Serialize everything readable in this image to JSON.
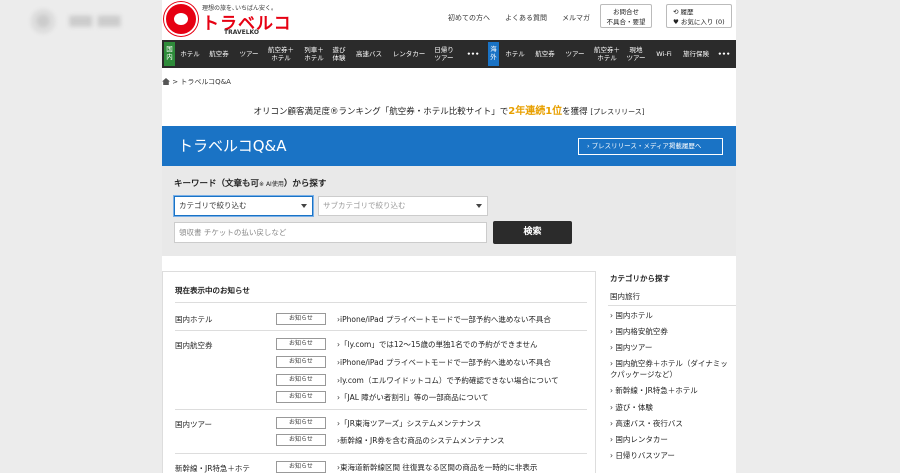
{
  "header": {
    "tagline": "理想の旅を､いちばん安く｡",
    "brand": "トラベルコ",
    "brand_en": "TRAVELKO",
    "links": [
      "初めての方へ",
      "よくある質問",
      "メルマガ"
    ],
    "inquiry_line1": "お問合せ",
    "inquiry_line2": "不具合・要望",
    "history_label": "履歴",
    "favorites_label": "お気に入り (0)"
  },
  "nav": {
    "domestic_tag": "国内",
    "domestic": [
      "ホテル",
      "航空券",
      "ツアー",
      "航空券＋\nホテル",
      "列車＋\nホテル",
      "遊び\n体験",
      "高速バス",
      "レンタカー",
      "日帰り\nツアー",
      "•••"
    ],
    "overseas_tag": "海外",
    "overseas": [
      "ホテル",
      "航空券",
      "ツアー",
      "航空券＋\nホテル",
      "現地\nツアー",
      "Wi-Fi",
      "旅行保険",
      "•••"
    ]
  },
  "breadcrumb": "> トラベルコQ&A",
  "promo": {
    "prefix": "オリコン顧客満足度®ランキング「航空券・ホテル比較サイト」で",
    "highlight": "2年連続1位",
    "suffix": "を獲得",
    "link": "[プレスリリース]"
  },
  "qa": {
    "title": "トラベルコQ&A",
    "press_button": "› プレスリリース・メディア掲載履歴へ"
  },
  "search": {
    "heading": "キーワード（文章も可",
    "ai_note": "※ AI使用",
    "heading_end": "）から探す",
    "category_select": "カテゴリで絞り込む",
    "subcategory_select": "サブカテゴリで絞り込む",
    "keyword_placeholder": "領収書 チケットの払い戻しなど",
    "search_button": "検索"
  },
  "notices": {
    "title": "現在表示中のお知らせ",
    "badge": "お知らせ",
    "groups": [
      {
        "category": "国内ホテル",
        "items": [
          "›iPhone/iPad プライベートモードで一部予約へ進めない不具合"
        ]
      },
      {
        "category": "国内航空券",
        "items": [
          "›「ly.com」では12～15歳の単独1名での予約ができません",
          "›iPhone/iPad プライベートモードで一部予約へ進めない不具合",
          "›ly.com（エルワイドットコム）で予約確認できない場合について",
          "›「JAL 障がい者割引」等の一部商品について"
        ]
      },
      {
        "category": "国内ツアー",
        "items": [
          "›「JR東海ツアーズ」システムメンテナンス",
          "›新幹線・JR券を含む商品のシステムメンテナンス"
        ]
      },
      {
        "category": "新幹線・JR特急＋ホテ",
        "items": [
          "›東海道新幹線区間 往復異なる区間の商品を一時的に非表示"
        ]
      }
    ]
  },
  "categories": {
    "heading": "カテゴリから探す",
    "sub": "国内旅行",
    "items": [
      "› 国内ホテル",
      "› 国内格安航空券",
      "› 国内ツアー",
      "› 国内航空券＋ホテル（ダイナミックパッケージなど）",
      "› 新幹線・JR特急＋ホテル",
      "› 遊び・体験",
      "› 高速バス・夜行バス",
      "› 国内レンタカー",
      "› 日帰りバスツアー"
    ]
  },
  "colors": {
    "brand_red": "#e60012",
    "qa_blue": "#1a73c5",
    "nav_dark": "#2b2b2b",
    "domestic_green": "#2e8b3a",
    "overseas_blue": "#1a73c5",
    "highlight_orange": "#e8a000"
  }
}
